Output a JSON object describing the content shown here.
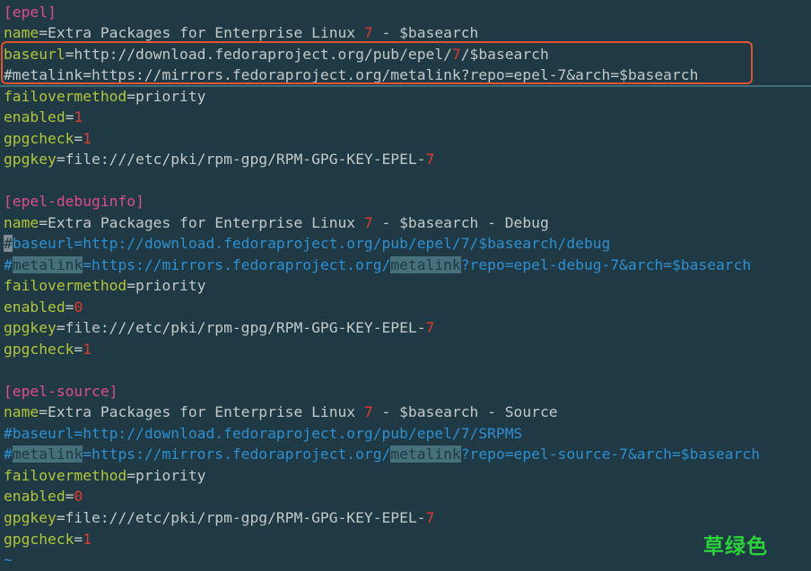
{
  "colors": {
    "background": "#1f3a44",
    "section": "#e04a8f",
    "key": "#b2c53a",
    "value": "#c2c9c9",
    "number": "#e5382f",
    "comment": "#2f8fd0",
    "highlight_box": "#e0542f",
    "watermark": "#2bd13a"
  },
  "lines": [
    {
      "segs": [
        {
          "t": "[epel]",
          "c": "sec"
        }
      ]
    },
    {
      "segs": [
        {
          "t": "name",
          "c": "key"
        },
        {
          "t": "=Extra Packages for Enterprise Linux ",
          "c": "val"
        },
        {
          "t": "7",
          "c": "num"
        },
        {
          "t": " - $basearch",
          "c": "val"
        }
      ]
    },
    {
      "segs": [
        {
          "t": "baseurl",
          "c": "key"
        },
        {
          "t": "=http://download.fedoraproject.org/pub/epel/",
          "c": "val"
        },
        {
          "t": "7",
          "c": "num"
        },
        {
          "t": "/$basearch",
          "c": "val"
        }
      ]
    },
    {
      "segs": [
        {
          "t": "#metalink=https://mirrors.fedoraproject.org/metalink?repo=epel-7&arch=$basearch",
          "c": "val"
        }
      ]
    },
    {
      "segs": [
        {
          "t": "failovermethod",
          "c": "key"
        },
        {
          "t": "=priority",
          "c": "val"
        }
      ]
    },
    {
      "segs": [
        {
          "t": "enabled",
          "c": "key"
        },
        {
          "t": "=",
          "c": "val"
        },
        {
          "t": "1",
          "c": "num"
        }
      ]
    },
    {
      "segs": [
        {
          "t": "gpgcheck",
          "c": "key"
        },
        {
          "t": "=",
          "c": "val"
        },
        {
          "t": "1",
          "c": "num"
        }
      ]
    },
    {
      "segs": [
        {
          "t": "gpgkey",
          "c": "key"
        },
        {
          "t": "=file:///etc/pki/rpm-gpg/RPM-GPG-KEY-EPEL-",
          "c": "val"
        },
        {
          "t": "7",
          "c": "num"
        }
      ]
    },
    {
      "segs": []
    },
    {
      "segs": [
        {
          "t": "[epel-debuginfo]",
          "c": "sec"
        }
      ]
    },
    {
      "segs": [
        {
          "t": "name",
          "c": "key"
        },
        {
          "t": "=Extra Packages for Enterprise Linux ",
          "c": "val"
        },
        {
          "t": "7",
          "c": "num"
        },
        {
          "t": " - $basearch - Debug",
          "c": "val"
        }
      ]
    },
    {
      "segs": [
        {
          "t": "#",
          "c": "cursor"
        },
        {
          "t": "baseurl=http://download.fedoraproject.org/pub/epel/7/$basearch/debug",
          "c": "com"
        }
      ]
    },
    {
      "segs": [
        {
          "t": "#",
          "c": "com"
        },
        {
          "t": "metalink",
          "c": "hl"
        },
        {
          "t": "=https://mirrors.fedoraproject.org/",
          "c": "com"
        },
        {
          "t": "metalink",
          "c": "hl"
        },
        {
          "t": "?repo=epel-debug-7&arch=$basearch",
          "c": "com"
        }
      ]
    },
    {
      "segs": [
        {
          "t": "failovermethod",
          "c": "key"
        },
        {
          "t": "=priority",
          "c": "val"
        }
      ]
    },
    {
      "segs": [
        {
          "t": "enabled",
          "c": "key"
        },
        {
          "t": "=",
          "c": "val"
        },
        {
          "t": "0",
          "c": "num"
        }
      ]
    },
    {
      "segs": [
        {
          "t": "gpgkey",
          "c": "key"
        },
        {
          "t": "=file:///etc/pki/rpm-gpg/RPM-GPG-KEY-EPEL-",
          "c": "val"
        },
        {
          "t": "7",
          "c": "num"
        }
      ]
    },
    {
      "segs": [
        {
          "t": "gpgcheck",
          "c": "key"
        },
        {
          "t": "=",
          "c": "val"
        },
        {
          "t": "1",
          "c": "num"
        }
      ]
    },
    {
      "segs": []
    },
    {
      "segs": [
        {
          "t": "[epel-source]",
          "c": "sec"
        }
      ]
    },
    {
      "segs": [
        {
          "t": "name",
          "c": "key"
        },
        {
          "t": "=Extra Packages for Enterprise Linux ",
          "c": "val"
        },
        {
          "t": "7",
          "c": "num"
        },
        {
          "t": " - $basearch - Source",
          "c": "val"
        }
      ]
    },
    {
      "segs": [
        {
          "t": "#baseurl=http://download.fedoraproject.org/pub/epel/7/SRPMS",
          "c": "com"
        }
      ]
    },
    {
      "segs": [
        {
          "t": "#",
          "c": "com"
        },
        {
          "t": "metalink",
          "c": "hl"
        },
        {
          "t": "=https://mirrors.fedoraproject.org/",
          "c": "com"
        },
        {
          "t": "metalink",
          "c": "hl"
        },
        {
          "t": "?repo=epel-source-7&arch=$basearch",
          "c": "com"
        }
      ]
    },
    {
      "segs": [
        {
          "t": "failovermethod",
          "c": "key"
        },
        {
          "t": "=priority",
          "c": "val"
        }
      ]
    },
    {
      "segs": [
        {
          "t": "enabled",
          "c": "key"
        },
        {
          "t": "=",
          "c": "val"
        },
        {
          "t": "0",
          "c": "num"
        }
      ]
    },
    {
      "segs": [
        {
          "t": "gpgkey",
          "c": "key"
        },
        {
          "t": "=file:///etc/pki/rpm-gpg/RPM-GPG-KEY-EPEL-",
          "c": "val"
        },
        {
          "t": "7",
          "c": "num"
        }
      ]
    },
    {
      "segs": [
        {
          "t": "gpgcheck",
          "c": "key"
        },
        {
          "t": "=",
          "c": "val"
        },
        {
          "t": "1",
          "c": "num"
        }
      ]
    },
    {
      "segs": [
        {
          "t": "~",
          "c": "tilde"
        }
      ]
    }
  ],
  "watermark": "草绿色"
}
